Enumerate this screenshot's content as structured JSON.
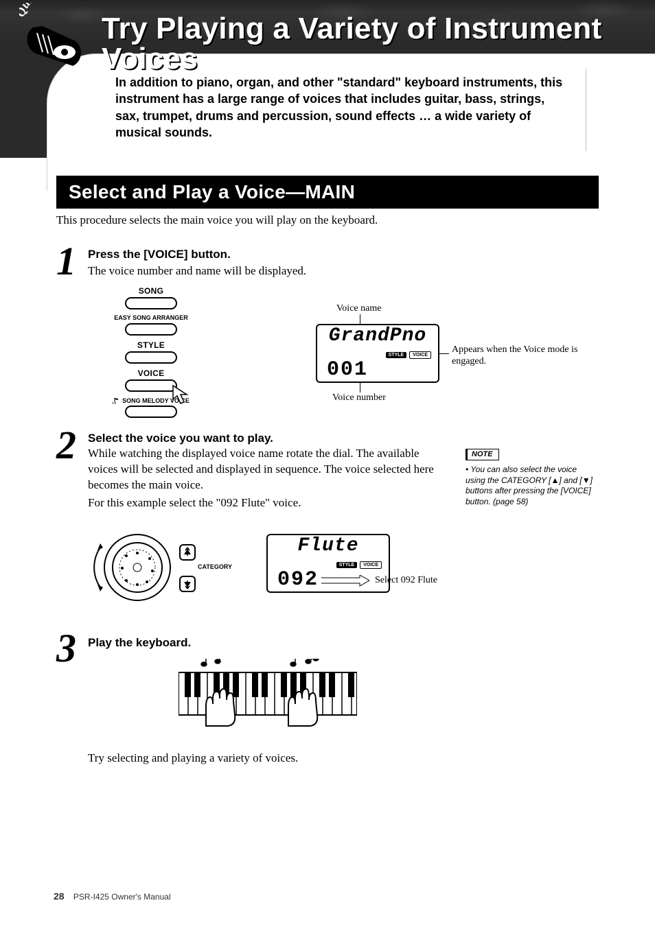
{
  "badge": "Quick Guide",
  "title": "Try Playing a Variety of Instrument Voices",
  "intro": "In addition to piano, organ, and other \"standard\" keyboard instruments, this instrument has a large range of voices that includes guitar, bass, strings, sax, trumpet, drums and percussion, sound effects … a wide variety of musical sounds.",
  "section": {
    "title": "Select and Play a Voice—MAIN"
  },
  "section_intro": "This procedure selects the main voice you will play on the keyboard.",
  "steps": [
    {
      "n": "1",
      "head": "Press the [VOICE] button.",
      "body": "The voice number and name will be displayed."
    },
    {
      "n": "2",
      "head": "Select the voice you want to play.",
      "body": "While watching the displayed voice name rotate the dial. The available voices will be selected and displayed in sequence. The voice selected here becomes the main voice.",
      "body2": "For this example select the \"092 Flute\" voice."
    },
    {
      "n": "3",
      "head": "Play the keyboard.",
      "outro": "Try selecting and playing a variety of voices."
    }
  ],
  "button_panel": {
    "song": "SONG",
    "easy": "EASY SONG ARRANGER",
    "style": "STYLE",
    "voice": "VOICE",
    "smv": "SONG MELODY VOICE"
  },
  "display1": {
    "name": "GrandPno",
    "num": "001",
    "pill1": "STYLE",
    "pill2": "VOICE",
    "caption_top": "Voice name",
    "caption_bottom": "Voice number",
    "side": "Appears when the Voice mode is engaged."
  },
  "display2": {
    "name": "Flute",
    "num": "092",
    "pill1": "STYLE",
    "pill2": "VOICE",
    "side": "Select 092 Flute"
  },
  "dial": {
    "category": "CATEGORY"
  },
  "note": {
    "head": "NOTE",
    "body": "You can also select the voice using the CATEGORY [▲] and [▼] buttons after pressing the [VOICE] button. (page 58)"
  },
  "footer": {
    "page": "28",
    "doc": "PSR-I425  Owner's Manual"
  }
}
